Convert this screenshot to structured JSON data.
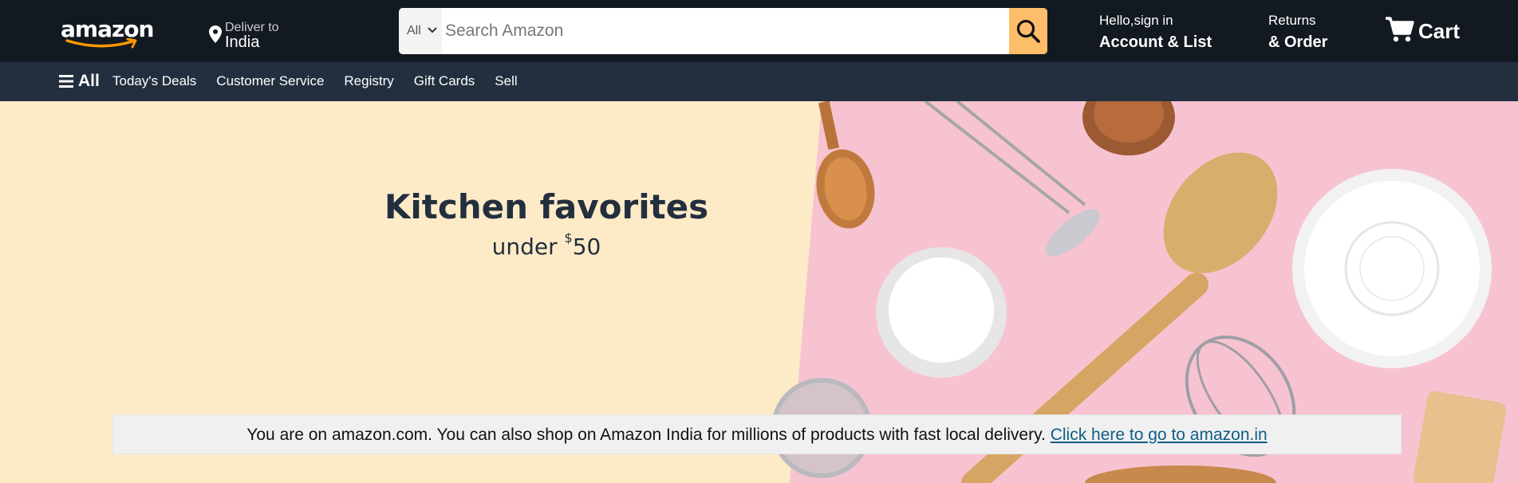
{
  "header": {
    "logo_text": "amazon",
    "deliver_line1": "Deliver to",
    "deliver_location": "India",
    "search_category": "All",
    "search_placeholder": "Search Amazon",
    "account_line1": "Hello,sign in",
    "account_line2": "Account & List",
    "returns_line1": "Returns",
    "returns_line2": "& Order",
    "cart_label": "Cart"
  },
  "subnav": {
    "all_label": "All",
    "items": [
      "Today's Deals",
      "Customer Service",
      "Registry",
      "Gift Cards",
      "Sell"
    ]
  },
  "hero": {
    "title": "Kitchen favorites",
    "subtitle_prefix": "under ",
    "subtitle_currency": "$",
    "subtitle_amount": "50"
  },
  "banner": {
    "text": "You are on amazon.com. You can also shop on Amazon India for millions of products with fast local delivery. ",
    "link": "Click here to go to amazon.in"
  },
  "icons": {
    "logo": "amazon-smile-logo",
    "location": "location-pin-icon",
    "category_dropdown": "chevron-down-icon",
    "search": "search-icon",
    "cart": "cart-icon",
    "menu": "hamburger-menu-icon"
  },
  "colors": {
    "topnav_bg": "#131921",
    "subnav_bg": "#232f3e",
    "search_button": "#febd69",
    "hero_left_bg": "#fdebc8",
    "hero_right_bg": "#f8c3d1",
    "banner_bg": "#f0f0f0",
    "link": "#0f5d86"
  }
}
